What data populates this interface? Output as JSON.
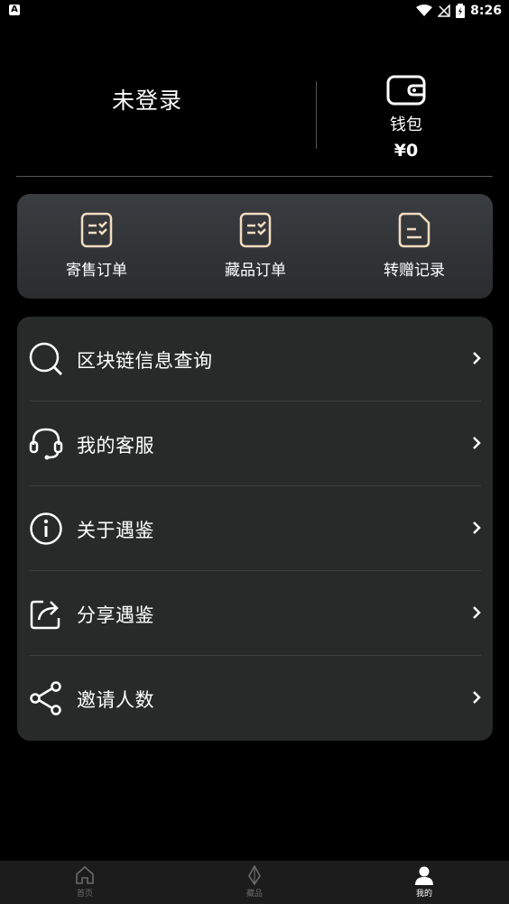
{
  "status_bar": {
    "app_icon": "A",
    "time": "8:26"
  },
  "header": {
    "login_text": "未登录",
    "wallet": {
      "label": "钱包",
      "balance": "¥0"
    }
  },
  "orders": [
    {
      "label": "寄售订单",
      "icon": "consignment-order-icon"
    },
    {
      "label": "藏品订单",
      "icon": "collection-order-icon"
    },
    {
      "label": "转赠记录",
      "icon": "transfer-record-icon"
    }
  ],
  "menu": [
    {
      "label": "区块链信息查询",
      "icon": "search-icon"
    },
    {
      "label": "我的客服",
      "icon": "headset-icon"
    },
    {
      "label": "关于遇鉴",
      "icon": "info-icon"
    },
    {
      "label": "分享遇鉴",
      "icon": "share-icon"
    },
    {
      "label": "邀请人数",
      "icon": "invite-share-icon"
    }
  ],
  "bottom_nav": [
    {
      "label": "首页",
      "icon": "home-icon",
      "active": false
    },
    {
      "label": "藏品",
      "icon": "collection-icon",
      "active": false
    },
    {
      "label": "我的",
      "icon": "profile-icon",
      "active": true
    }
  ],
  "colors": {
    "background": "#000000",
    "card": "#282a2a",
    "accent": "#f3dcc0",
    "inactive": "#6a6a6a"
  }
}
